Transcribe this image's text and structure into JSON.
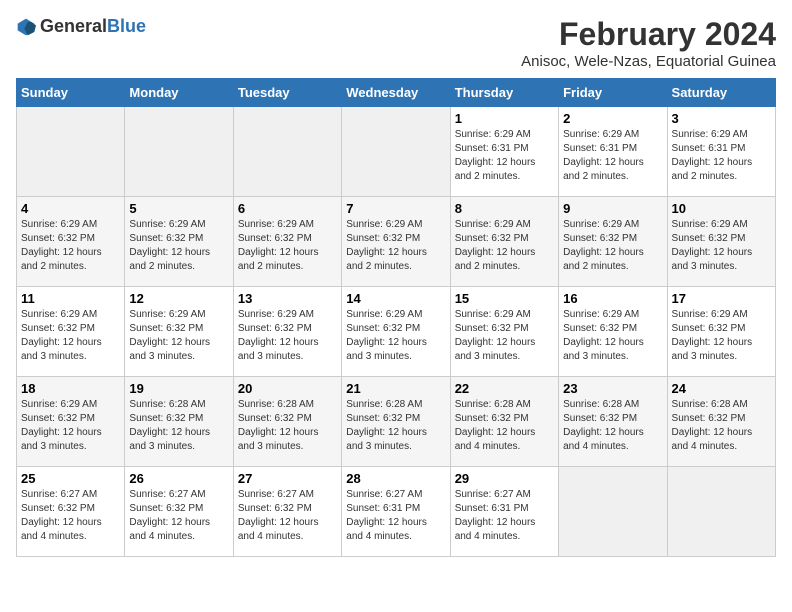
{
  "logo": {
    "general": "General",
    "blue": "Blue"
  },
  "title": "February 2024",
  "subtitle": "Anisoc, Wele-Nzas, Equatorial Guinea",
  "days_of_week": [
    "Sunday",
    "Monday",
    "Tuesday",
    "Wednesday",
    "Thursday",
    "Friday",
    "Saturday"
  ],
  "weeks": [
    [
      {
        "day": "",
        "info": ""
      },
      {
        "day": "",
        "info": ""
      },
      {
        "day": "",
        "info": ""
      },
      {
        "day": "",
        "info": ""
      },
      {
        "day": "1",
        "info": "Sunrise: 6:29 AM\nSunset: 6:31 PM\nDaylight: 12 hours\nand 2 minutes."
      },
      {
        "day": "2",
        "info": "Sunrise: 6:29 AM\nSunset: 6:31 PM\nDaylight: 12 hours\nand 2 minutes."
      },
      {
        "day": "3",
        "info": "Sunrise: 6:29 AM\nSunset: 6:31 PM\nDaylight: 12 hours\nand 2 minutes."
      }
    ],
    [
      {
        "day": "4",
        "info": "Sunrise: 6:29 AM\nSunset: 6:32 PM\nDaylight: 12 hours\nand 2 minutes."
      },
      {
        "day": "5",
        "info": "Sunrise: 6:29 AM\nSunset: 6:32 PM\nDaylight: 12 hours\nand 2 minutes."
      },
      {
        "day": "6",
        "info": "Sunrise: 6:29 AM\nSunset: 6:32 PM\nDaylight: 12 hours\nand 2 minutes."
      },
      {
        "day": "7",
        "info": "Sunrise: 6:29 AM\nSunset: 6:32 PM\nDaylight: 12 hours\nand 2 minutes."
      },
      {
        "day": "8",
        "info": "Sunrise: 6:29 AM\nSunset: 6:32 PM\nDaylight: 12 hours\nand 2 minutes."
      },
      {
        "day": "9",
        "info": "Sunrise: 6:29 AM\nSunset: 6:32 PM\nDaylight: 12 hours\nand 2 minutes."
      },
      {
        "day": "10",
        "info": "Sunrise: 6:29 AM\nSunset: 6:32 PM\nDaylight: 12 hours\nand 3 minutes."
      }
    ],
    [
      {
        "day": "11",
        "info": "Sunrise: 6:29 AM\nSunset: 6:32 PM\nDaylight: 12 hours\nand 3 minutes."
      },
      {
        "day": "12",
        "info": "Sunrise: 6:29 AM\nSunset: 6:32 PM\nDaylight: 12 hours\nand 3 minutes."
      },
      {
        "day": "13",
        "info": "Sunrise: 6:29 AM\nSunset: 6:32 PM\nDaylight: 12 hours\nand 3 minutes."
      },
      {
        "day": "14",
        "info": "Sunrise: 6:29 AM\nSunset: 6:32 PM\nDaylight: 12 hours\nand 3 minutes."
      },
      {
        "day": "15",
        "info": "Sunrise: 6:29 AM\nSunset: 6:32 PM\nDaylight: 12 hours\nand 3 minutes."
      },
      {
        "day": "16",
        "info": "Sunrise: 6:29 AM\nSunset: 6:32 PM\nDaylight: 12 hours\nand 3 minutes."
      },
      {
        "day": "17",
        "info": "Sunrise: 6:29 AM\nSunset: 6:32 PM\nDaylight: 12 hours\nand 3 minutes."
      }
    ],
    [
      {
        "day": "18",
        "info": "Sunrise: 6:29 AM\nSunset: 6:32 PM\nDaylight: 12 hours\nand 3 minutes."
      },
      {
        "day": "19",
        "info": "Sunrise: 6:28 AM\nSunset: 6:32 PM\nDaylight: 12 hours\nand 3 minutes."
      },
      {
        "day": "20",
        "info": "Sunrise: 6:28 AM\nSunset: 6:32 PM\nDaylight: 12 hours\nand 3 minutes."
      },
      {
        "day": "21",
        "info": "Sunrise: 6:28 AM\nSunset: 6:32 PM\nDaylight: 12 hours\nand 3 minutes."
      },
      {
        "day": "22",
        "info": "Sunrise: 6:28 AM\nSunset: 6:32 PM\nDaylight: 12 hours\nand 4 minutes."
      },
      {
        "day": "23",
        "info": "Sunrise: 6:28 AM\nSunset: 6:32 PM\nDaylight: 12 hours\nand 4 minutes."
      },
      {
        "day": "24",
        "info": "Sunrise: 6:28 AM\nSunset: 6:32 PM\nDaylight: 12 hours\nand 4 minutes."
      }
    ],
    [
      {
        "day": "25",
        "info": "Sunrise: 6:27 AM\nSunset: 6:32 PM\nDaylight: 12 hours\nand 4 minutes."
      },
      {
        "day": "26",
        "info": "Sunrise: 6:27 AM\nSunset: 6:32 PM\nDaylight: 12 hours\nand 4 minutes."
      },
      {
        "day": "27",
        "info": "Sunrise: 6:27 AM\nSunset: 6:32 PM\nDaylight: 12 hours\nand 4 minutes."
      },
      {
        "day": "28",
        "info": "Sunrise: 6:27 AM\nSunset: 6:31 PM\nDaylight: 12 hours\nand 4 minutes."
      },
      {
        "day": "29",
        "info": "Sunrise: 6:27 AM\nSunset: 6:31 PM\nDaylight: 12 hours\nand 4 minutes."
      },
      {
        "day": "",
        "info": ""
      },
      {
        "day": "",
        "info": ""
      }
    ]
  ]
}
